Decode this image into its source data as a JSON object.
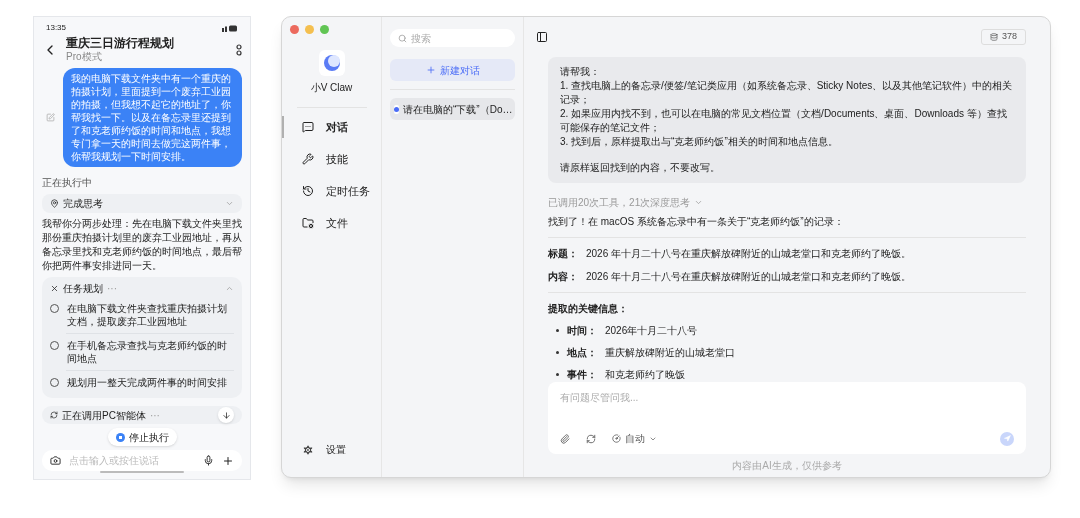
{
  "phone": {
    "status_time": "13:35",
    "title": "重庆三日游行程规划",
    "subtitle": "Pro模式",
    "user_message": "我的电脑下载文件夹中有一个重庆的拍摄计划，里面提到一个废弃工业园的拍摄，但我想不起它的地址了，你帮我找一下。以及在备忘录里还提到了和克老师约饭的时间和地点，我想专门拿一天的时间去做完这两件事，你帮我规划一下时间安排。",
    "status_label": "正在执行中",
    "thinking": {
      "label": "完成思考",
      "expanded": false
    },
    "reply": "我帮你分两步处理：先在电脑下载文件夹里找那份重庆拍摄计划里的废弃工业园地址，再从备忘录里找和克老师约饭的时间地点，最后帮你把两件事安排进同一天。",
    "task_plan": {
      "title": "任务规划",
      "dots": "···",
      "expanded": true,
      "tasks": [
        {
          "text": "在电脑下载文件夹查找重庆拍摄计划文档，提取废弃工业园地址",
          "checked": false
        },
        {
          "text": "在手机备忘录查找与克老师约饭的时间地点",
          "checked": false
        },
        {
          "text": "规划用一整天完成两件事的时间安排",
          "checked": false
        }
      ]
    },
    "agent_call": {
      "label": "正在调用PC智能体",
      "dots": "···"
    },
    "stop_button": "停止执行",
    "input": {
      "placeholder": "点击输入或按住说话"
    }
  },
  "desktop": {
    "app_name": "小V Claw",
    "nav": [
      {
        "label": "对话",
        "kind": "chat",
        "selected": true
      },
      {
        "label": "技能",
        "kind": "skills",
        "selected": false
      },
      {
        "label": "定时任务",
        "kind": "schedule",
        "selected": false
      },
      {
        "label": "文件",
        "kind": "files",
        "selected": false
      }
    ],
    "settings": "设置",
    "search": {
      "placeholder": "搜索"
    },
    "new_chat": "新建对话",
    "conversations": [
      {
        "title": "请在电脑的“下载”（Do…",
        "selected": true
      }
    ],
    "token_count": "378",
    "prompt_paragraphs": [
      [
        "请帮我：",
        "1. 查找电脑上的备忘录/便签/笔记类应用（如系统备忘录、Sticky Notes、以及其他笔记软件）中的相关记录；",
        "2. 如果应用内找不到，也可以在电脑的常见文档位置（文档/Documents、桌面、Downloads 等）查找可能保存的笔记文件；",
        "3. 找到后，原样提取出与“克老师约饭”相关的时间和地点信息。"
      ],
      [
        "请原样返回找到的内容，不要改写。"
      ]
    ],
    "tools_summary": "已调用20次工具，21次深度思考",
    "answer_intro": "找到了！在 macOS 系统备忘录中有一条关于“克老师约饭”的记录：",
    "fields": [
      {
        "label": "标题：",
        "value": "2026 年十月二十八号在重庆解放碑附近的山城老堂口和克老师约了晚饭。"
      },
      {
        "label": "内容：",
        "value": "2026 年十月二十八号在重庆解放碑附近的山城老堂口和克老师约了晚饭。"
      }
    ],
    "key_info_title": "提取的关键信息：",
    "key_info": [
      {
        "label": "时间：",
        "value": "2026年十月二十八号"
      },
      {
        "label": "地点：",
        "value": "重庆解放碑附近的山城老堂口"
      },
      {
        "label": "事件：",
        "value": "和克老师约了晚饭"
      }
    ],
    "input": {
      "placeholder": "有问题尽管问我..."
    },
    "mode": "自动",
    "footer": "内容由AI生成，仅供参考"
  }
}
